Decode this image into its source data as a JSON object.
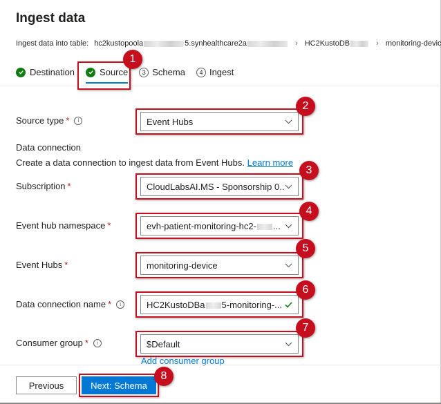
{
  "header": {
    "title": "Ingest data",
    "breadcrumb_label": "Ingest data into table:",
    "crumb_cluster_a": "hc2kustopoola",
    "crumb_cluster_b": "5.synhealthcare2a",
    "crumb_db": "HC2KustoDB",
    "crumb_table": "monitoring-device"
  },
  "steps": [
    {
      "label": "Destination",
      "state": "done"
    },
    {
      "label": "Source",
      "state": "active"
    },
    {
      "label": "Schema",
      "number": "3"
    },
    {
      "label": "Ingest",
      "number": "4"
    }
  ],
  "form": {
    "source_type": {
      "label": "Source type",
      "required": "*",
      "value": "Event Hubs"
    },
    "data_connection_title": "Data connection",
    "data_connection_desc": "Create a data connection to ingest data from Event Hubs.",
    "learn_more": "Learn more",
    "subscription": {
      "label": "Subscription",
      "required": "*",
      "value": "CloudLabsAI.MS - Sponsorship 0..."
    },
    "namespace": {
      "label": "Event hub namespace",
      "required": "*",
      "value_a": "evh-patient-monitoring-hc2-",
      "value_b": "..."
    },
    "event_hubs": {
      "label": "Event Hubs",
      "required": "*",
      "value": "monitoring-device"
    },
    "connection_name": {
      "label": "Data connection name",
      "required": "*",
      "value_a": "HC2KustoDBa",
      "value_b": "5-monitoring-..."
    },
    "consumer_group": {
      "label": "Consumer group",
      "required": "*",
      "value": "$Default"
    },
    "add_consumer_group": "Add consumer group"
  },
  "footer": {
    "previous": "Previous",
    "next": "Next: Schema"
  },
  "callouts": [
    "1",
    "2",
    "3",
    "4",
    "5",
    "6",
    "7",
    "8"
  ],
  "colors": {
    "accent": "#0078d4",
    "success": "#107c10",
    "callout": "#c50f1f"
  }
}
